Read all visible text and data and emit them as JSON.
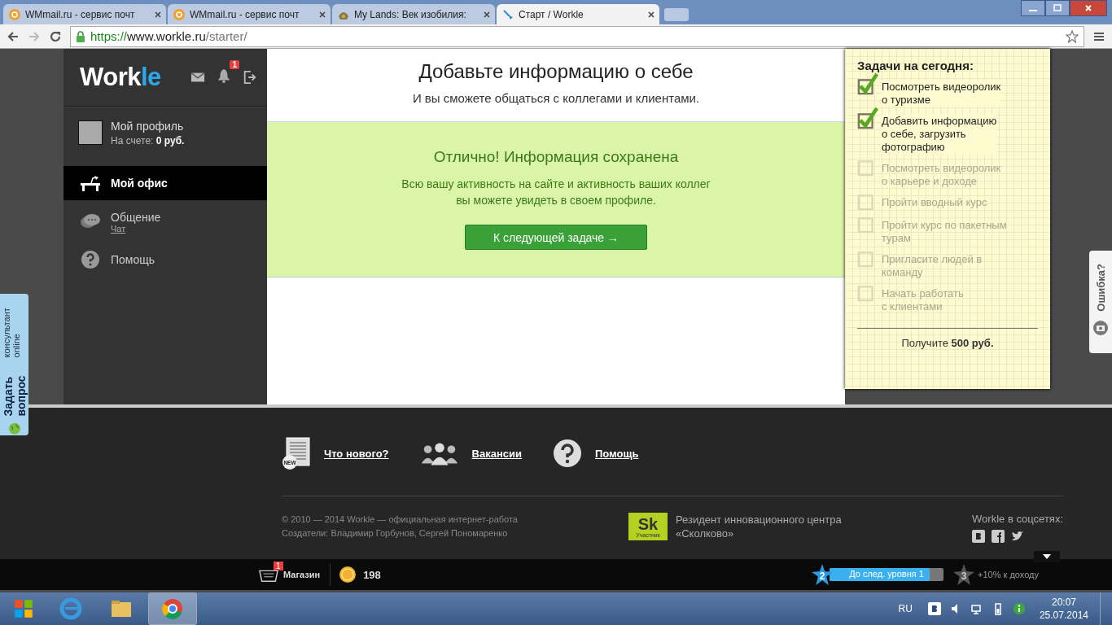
{
  "browser": {
    "tabs": [
      {
        "title": "WMmail.ru - сервис почт",
        "selected": false,
        "kind": "mail"
      },
      {
        "title": "WMmail.ru - сервис почт",
        "selected": false,
        "kind": "mail"
      },
      {
        "title": "My Lands: Век изобилия:",
        "selected": false,
        "kind": "game"
      },
      {
        "title": "Старт / Workle",
        "selected": true,
        "kind": "workle"
      }
    ],
    "url": {
      "scheme": "https://",
      "host": "www.workle.ru",
      "path": "/starter/"
    }
  },
  "sidebar": {
    "logo": {
      "main": "Work",
      "accent": "le"
    },
    "notification_count": "1",
    "profile": {
      "name": "Мой профиль",
      "balance_label": "На счете:",
      "balance": "0 руб."
    },
    "nav": [
      {
        "label": "Мой офис",
        "selected": true,
        "kind": "office"
      },
      {
        "label": "Общение",
        "sublink": "Чат",
        "selected": false,
        "kind": "chat"
      },
      {
        "label": "Помощь",
        "selected": false,
        "kind": "help"
      }
    ]
  },
  "main": {
    "title": "Добавьте информацию о себе",
    "subtitle": "И вы сможете общаться с коллегами и клиентами.",
    "success": {
      "title": "Отлично! Информация сохранена",
      "lines": [
        "Всю вашу активность на сайте и активность ваших коллег",
        "вы можете увидеть в своем профиле."
      ],
      "button": "К следующей задаче →"
    }
  },
  "tasks": {
    "title": "Задачи на сегодня:",
    "items": [
      {
        "label": [
          "Посмотреть видеоролик",
          "о туризме"
        ],
        "checked": true
      },
      {
        "label": [
          "Добавить информацию",
          "о себе, загрузить",
          "фотографию"
        ],
        "checked": true
      },
      {
        "label": [
          "Посмотреть видеоролик",
          "о карьере и доходе"
        ],
        "checked": false
      },
      {
        "label": [
          "Пройти вводный курс"
        ],
        "checked": false
      },
      {
        "label": [
          "Пройти курс по пакетным",
          "турам"
        ],
        "checked": false
      },
      {
        "label": [
          "Пригласите людей в",
          "команду"
        ],
        "checked": false
      },
      {
        "label": [
          "Начать работать",
          "с клиентами"
        ],
        "checked": false
      }
    ],
    "reward": "Получите **500 руб.**"
  },
  "ask_widget": {
    "title": "Задать вопрос",
    "subtitle": "консультант online"
  },
  "error_widget": {
    "label": "Ошибка?"
  },
  "footer": {
    "links": [
      {
        "label": "Что нового?",
        "kind": "news",
        "badge": "NEW"
      },
      {
        "label": "Вакансии",
        "kind": "jobs"
      },
      {
        "label": "Помощь",
        "kind": "help"
      }
    ],
    "copyright": [
      "© 2010 — 2014 Workle — официальная интернет-работа",
      "Создатели: Владимир Горбунов, Сергей Пономаренко"
    ],
    "skolkovo": {
      "logo": "Sk",
      "badge": "Участник",
      "text": [
        "Резидент инновационного центра",
        "«Сколково»"
      ]
    },
    "social_title": "Workle в соцсетях:"
  },
  "bottom_bar": {
    "shop": "Магазин",
    "shop_count": "1",
    "coins": "198",
    "level": "2",
    "progress_label": "До след. уровня 1",
    "progress": {
      "level": 0.88
    },
    "next_level": "3",
    "next_bonus": "+10% к доходу"
  },
  "taskbar": {
    "language": "RU",
    "time": "20:07",
    "date": "25.07.2014"
  }
}
